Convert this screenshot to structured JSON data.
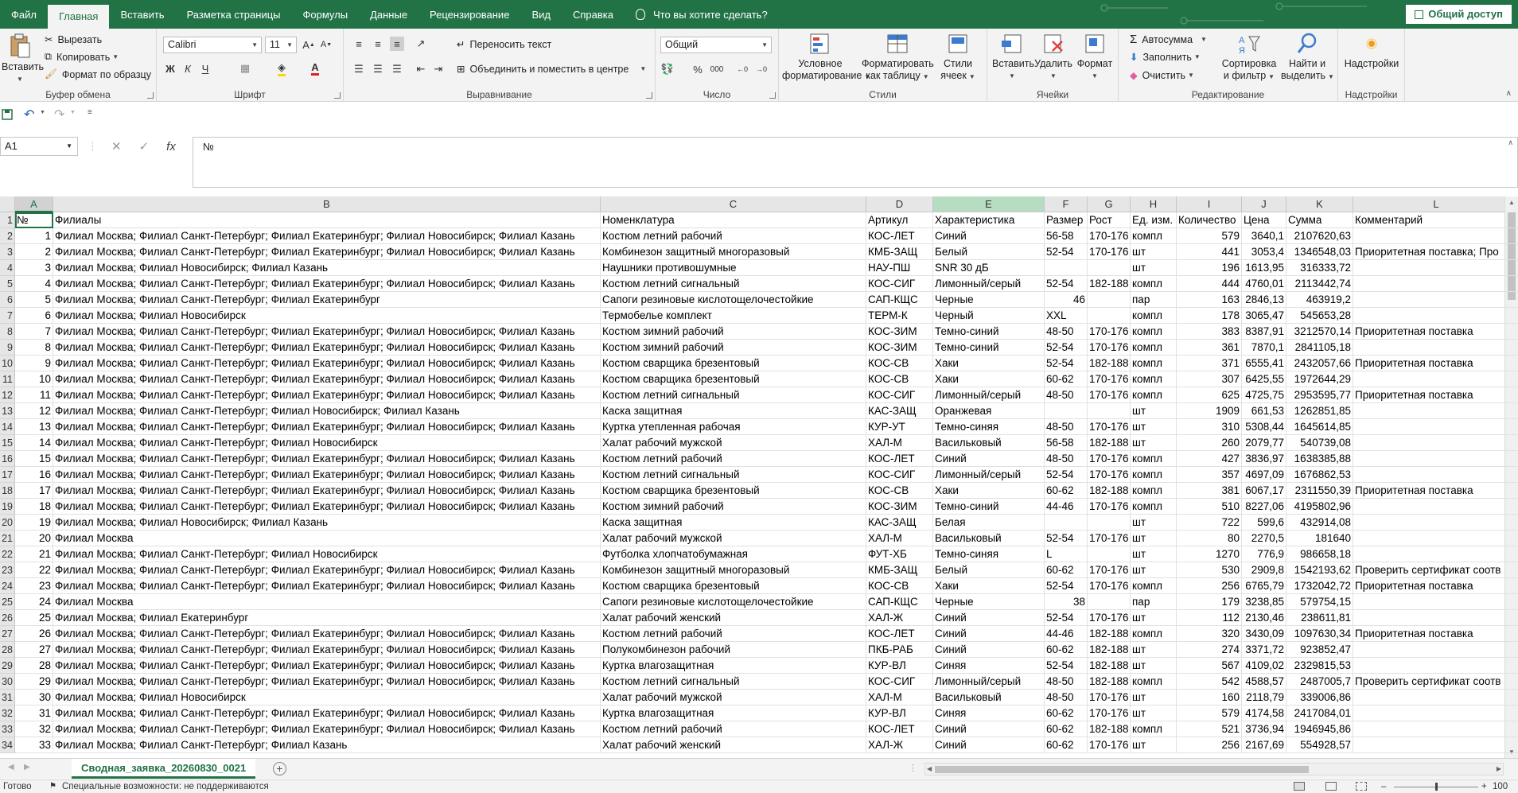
{
  "tabs": [
    "Файл",
    "Главная",
    "Вставить",
    "Разметка страницы",
    "Формулы",
    "Данные",
    "Рецензирование",
    "Вид",
    "Справка"
  ],
  "tell_me": "Что вы хотите сделать?",
  "share": "Общий доступ",
  "ribbon": {
    "clipboard": {
      "paste": "Вставить",
      "cut": "Вырезать",
      "copy": "Копировать",
      "format_painter": "Формат по образцу",
      "label": "Буфер обмена"
    },
    "font": {
      "name": "Calibri",
      "size": "11",
      "bold": "Ж",
      "italic": "К",
      "underline": "Ч",
      "label": "Шрифт"
    },
    "alignment": {
      "wrap": "Переносить текст",
      "merge": "Объединить и поместить в центре",
      "label": "Выравнивание"
    },
    "number": {
      "format": "Общий",
      "label": "Число"
    },
    "styles": {
      "conditional": "Условное форматирование",
      "as_table": "Форматировать как таблицу",
      "cell_styles": "Стили ячеек",
      "label": "Стили"
    },
    "cells": {
      "insert": "Вставить",
      "delete": "Удалить",
      "format": "Формат",
      "label": "Ячейки"
    },
    "editing": {
      "autosum": "Автосумма",
      "fill": "Заполнить",
      "clear": "Очистить",
      "sort": "Сортировка и фильтр",
      "find": "Найти и выделить",
      "label": "Редактирование"
    },
    "addins": {
      "addins": "Надстройки",
      "label": "Надстройки"
    }
  },
  "formula_bar": {
    "name_box": "A1",
    "content": "№"
  },
  "columns": [
    {
      "id": "A",
      "w": 48
    },
    {
      "id": "B",
      "w": 688
    },
    {
      "id": "C",
      "w": 334
    },
    {
      "id": "D",
      "w": 84
    },
    {
      "id": "E",
      "w": 140
    },
    {
      "id": "F",
      "w": 54
    },
    {
      "id": "G",
      "w": 54
    },
    {
      "id": "H",
      "w": 58
    },
    {
      "id": "I",
      "w": 82
    },
    {
      "id": "J",
      "w": 56
    },
    {
      "id": "K",
      "w": 84
    },
    {
      "id": "L",
      "w": 209
    }
  ],
  "headers": [
    "№",
    "Филиалы",
    "Номенклатура",
    "Артикул",
    "Характеристика",
    "Размер",
    "Рост",
    "Ед. изм.",
    "Количество",
    "Цена",
    "Сумма",
    "Комментарий"
  ],
  "rows": [
    [
      "1",
      "Филиал Москва; Филиал Санкт-Петербург; Филиал Екатеринбург; Филиал Новосибирск; Филиал Казань",
      "Костюм летний рабочий",
      "КОС-ЛЕТ",
      "Синий",
      "56-58",
      "170-176",
      "компл",
      "579",
      "3640,1",
      "2107620,63",
      ""
    ],
    [
      "2",
      "Филиал Москва; Филиал Санкт-Петербург; Филиал Екатеринбург; Филиал Новосибирск; Филиал Казань",
      "Комбинезон защитный многоразовый",
      "КМБ-ЗАЩ",
      "Белый",
      "52-54",
      "170-176",
      "шт",
      "441",
      "3053,4",
      "1346548,03",
      "Приоритетная поставка; Про"
    ],
    [
      "3",
      "Филиал Москва; Филиал Новосибирск; Филиал Казань",
      "Наушники противошумные",
      "НАУ-ПШ",
      "SNR 30 дБ",
      "",
      "",
      "шт",
      "196",
      "1613,95",
      "316333,72",
      ""
    ],
    [
      "4",
      "Филиал Москва; Филиал Санкт-Петербург; Филиал Екатеринбург; Филиал Новосибирск; Филиал Казань",
      "Костюм летний сигнальный",
      "КОС-СИГ",
      "Лимонный/серый",
      "52-54",
      "182-188",
      "компл",
      "444",
      "4760,01",
      "2113442,74",
      ""
    ],
    [
      "5",
      "Филиал Москва; Филиал Санкт-Петербург; Филиал Екатеринбург",
      "Сапоги резиновые кислотощелочестойкие",
      "САП-КЩС",
      "Черные",
      "46",
      "",
      "пар",
      "163",
      "2846,13",
      "463919,2",
      ""
    ],
    [
      "6",
      "Филиал Москва; Филиал Новосибирск",
      "Термобелье комплект",
      "ТЕРМ-К",
      "Черный",
      "XXL",
      "",
      "компл",
      "178",
      "3065,47",
      "545653,28",
      ""
    ],
    [
      "7",
      "Филиал Москва; Филиал Санкт-Петербург; Филиал Екатеринбург; Филиал Новосибирск; Филиал Казань",
      "Костюм зимний рабочий",
      "КОС-ЗИМ",
      "Темно-синий",
      "48-50",
      "170-176",
      "компл",
      "383",
      "8387,91",
      "3212570,14",
      "Приоритетная поставка"
    ],
    [
      "8",
      "Филиал Москва; Филиал Санкт-Петербург; Филиал Екатеринбург; Филиал Новосибирск; Филиал Казань",
      "Костюм зимний рабочий",
      "КОС-ЗИМ",
      "Темно-синий",
      "52-54",
      "170-176",
      "компл",
      "361",
      "7870,1",
      "2841105,18",
      ""
    ],
    [
      "9",
      "Филиал Москва; Филиал Санкт-Петербург; Филиал Екатеринбург; Филиал Новосибирск; Филиал Казань",
      "Костюм сварщика брезентовый",
      "КОС-СВ",
      "Хаки",
      "52-54",
      "182-188",
      "компл",
      "371",
      "6555,41",
      "2432057,66",
      "Приоритетная поставка"
    ],
    [
      "10",
      "Филиал Москва; Филиал Санкт-Петербург; Филиал Екатеринбург; Филиал Новосибирск; Филиал Казань",
      "Костюм сварщика брезентовый",
      "КОС-СВ",
      "Хаки",
      "60-62",
      "170-176",
      "компл",
      "307",
      "6425,55",
      "1972644,29",
      ""
    ],
    [
      "11",
      "Филиал Москва; Филиал Санкт-Петербург; Филиал Екатеринбург; Филиал Новосибирск; Филиал Казань",
      "Костюм летний сигнальный",
      "КОС-СИГ",
      "Лимонный/серый",
      "48-50",
      "170-176",
      "компл",
      "625",
      "4725,75",
      "2953595,77",
      "Приоритетная поставка"
    ],
    [
      "12",
      "Филиал Москва; Филиал Санкт-Петербург; Филиал Новосибирск; Филиал Казань",
      "Каска защитная",
      "КАС-ЗАЩ",
      "Оранжевая",
      "",
      "",
      "шт",
      "1909",
      "661,53",
      "1262851,85",
      ""
    ],
    [
      "13",
      "Филиал Москва; Филиал Санкт-Петербург; Филиал Екатеринбург; Филиал Новосибирск; Филиал Казань",
      "Куртка утепленная рабочая",
      "КУР-УТ",
      "Темно-синяя",
      "48-50",
      "170-176",
      "шт",
      "310",
      "5308,44",
      "1645614,85",
      ""
    ],
    [
      "14",
      "Филиал Москва; Филиал Санкт-Петербург; Филиал Новосибирск",
      "Халат рабочий мужской",
      "ХАЛ-М",
      "Васильковый",
      "56-58",
      "182-188",
      "шт",
      "260",
      "2079,77",
      "540739,08",
      ""
    ],
    [
      "15",
      "Филиал Москва; Филиал Санкт-Петербург; Филиал Екатеринбург; Филиал Новосибирск; Филиал Казань",
      "Костюм летний рабочий",
      "КОС-ЛЕТ",
      "Синий",
      "48-50",
      "170-176",
      "компл",
      "427",
      "3836,97",
      "1638385,88",
      ""
    ],
    [
      "16",
      "Филиал Москва; Филиал Санкт-Петербург; Филиал Екатеринбург; Филиал Новосибирск; Филиал Казань",
      "Костюм летний сигнальный",
      "КОС-СИГ",
      "Лимонный/серый",
      "52-54",
      "170-176",
      "компл",
      "357",
      "4697,09",
      "1676862,53",
      ""
    ],
    [
      "17",
      "Филиал Москва; Филиал Санкт-Петербург; Филиал Екатеринбург; Филиал Новосибирск; Филиал Казань",
      "Костюм сварщика брезентовый",
      "КОС-СВ",
      "Хаки",
      "60-62",
      "182-188",
      "компл",
      "381",
      "6067,17",
      "2311550,39",
      "Приоритетная поставка"
    ],
    [
      "18",
      "Филиал Москва; Филиал Санкт-Петербург; Филиал Екатеринбург; Филиал Новосибирск; Филиал Казань",
      "Костюм зимний рабочий",
      "КОС-ЗИМ",
      "Темно-синий",
      "44-46",
      "170-176",
      "компл",
      "510",
      "8227,06",
      "4195802,96",
      ""
    ],
    [
      "19",
      "Филиал Москва; Филиал Новосибирск; Филиал Казань",
      "Каска защитная",
      "КАС-ЗАЩ",
      "Белая",
      "",
      "",
      "шт",
      "722",
      "599,6",
      "432914,08",
      ""
    ],
    [
      "20",
      "Филиал Москва",
      "Халат рабочий мужской",
      "ХАЛ-М",
      "Васильковый",
      "52-54",
      "170-176",
      "шт",
      "80",
      "2270,5",
      "181640",
      ""
    ],
    [
      "21",
      "Филиал Москва; Филиал Санкт-Петербург; Филиал Новосибирск",
      "Футболка хлопчатобумажная",
      "ФУТ-ХБ",
      "Темно-синяя",
      "L",
      "",
      "шт",
      "1270",
      "776,9",
      "986658,18",
      ""
    ],
    [
      "22",
      "Филиал Москва; Филиал Санкт-Петербург; Филиал Екатеринбург; Филиал Новосибирск; Филиал Казань",
      "Комбинезон защитный многоразовый",
      "КМБ-ЗАЩ",
      "Белый",
      "60-62",
      "170-176",
      "шт",
      "530",
      "2909,8",
      "1542193,62",
      "Проверить сертификат соотв"
    ],
    [
      "23",
      "Филиал Москва; Филиал Санкт-Петербург; Филиал Екатеринбург; Филиал Новосибирск; Филиал Казань",
      "Костюм сварщика брезентовый",
      "КОС-СВ",
      "Хаки",
      "52-54",
      "170-176",
      "компл",
      "256",
      "6765,79",
      "1732042,72",
      "Приоритетная поставка"
    ],
    [
      "24",
      "Филиал Москва",
      "Сапоги резиновые кислотощелочестойкие",
      "САП-КЩС",
      "Черные",
      "38",
      "",
      "пар",
      "179",
      "3238,85",
      "579754,15",
      ""
    ],
    [
      "25",
      "Филиал Москва; Филиал Екатеринбург",
      "Халат рабочий женский",
      "ХАЛ-Ж",
      "Синий",
      "52-54",
      "170-176",
      "шт",
      "112",
      "2130,46",
      "238611,81",
      ""
    ],
    [
      "26",
      "Филиал Москва; Филиал Санкт-Петербург; Филиал Екатеринбург; Филиал Новосибирск; Филиал Казань",
      "Костюм летний рабочий",
      "КОС-ЛЕТ",
      "Синий",
      "44-46",
      "182-188",
      "компл",
      "320",
      "3430,09",
      "1097630,34",
      "Приоритетная поставка"
    ],
    [
      "27",
      "Филиал Москва; Филиал Санкт-Петербург; Филиал Екатеринбург; Филиал Новосибирск; Филиал Казань",
      "Полукомбинезон рабочий",
      "ПКБ-РАБ",
      "Синий",
      "60-62",
      "182-188",
      "шт",
      "274",
      "3371,72",
      "923852,47",
      ""
    ],
    [
      "28",
      "Филиал Москва; Филиал Санкт-Петербург; Филиал Екатеринбург; Филиал Новосибирск; Филиал Казань",
      "Куртка влагозащитная",
      "КУР-ВЛ",
      "Синяя",
      "52-54",
      "182-188",
      "шт",
      "567",
      "4109,02",
      "2329815,53",
      ""
    ],
    [
      "29",
      "Филиал Москва; Филиал Санкт-Петербург; Филиал Екатеринбург; Филиал Новосибирск; Филиал Казань",
      "Костюм летний сигнальный",
      "КОС-СИГ",
      "Лимонный/серый",
      "48-50",
      "182-188",
      "компл",
      "542",
      "4588,57",
      "2487005,7",
      "Проверить сертификат соотв"
    ],
    [
      "30",
      "Филиал Москва; Филиал Новосибирск",
      "Халат рабочий мужской",
      "ХАЛ-М",
      "Васильковый",
      "48-50",
      "170-176",
      "шт",
      "160",
      "2118,79",
      "339006,86",
      ""
    ],
    [
      "31",
      "Филиал Москва; Филиал Санкт-Петербург; Филиал Екатеринбург; Филиал Новосибирск; Филиал Казань",
      "Куртка влагозащитная",
      "КУР-ВЛ",
      "Синяя",
      "60-62",
      "170-176",
      "шт",
      "579",
      "4174,58",
      "2417084,01",
      ""
    ],
    [
      "32",
      "Филиал Москва; Филиал Санкт-Петербург; Филиал Екатеринбург; Филиал Новосибирск; Филиал Казань",
      "Костюм летний рабочий",
      "КОС-ЛЕТ",
      "Синий",
      "60-62",
      "182-188",
      "компл",
      "521",
      "3736,94",
      "1946945,86",
      ""
    ],
    [
      "33",
      "Филиал Москва; Филиал Санкт-Петербург; Филиал Казань",
      "Халат рабочий женский",
      "ХАЛ-Ж",
      "Синий",
      "60-62",
      "170-176",
      "шт",
      "256",
      "2167,69",
      "554928,57",
      ""
    ]
  ],
  "sheet_tab": "Сводная_заявка_20260830_0021",
  "status": {
    "ready": "Готово",
    "accessibility": "Специальные возможности: не поддерживаются",
    "zoom": "100 %"
  },
  "colors": {
    "accent": "#217346",
    "ribbon_bg": "#f3f3f3",
    "header_bg": "#e6e6e6",
    "highlight_col": "#b6dcc2"
  }
}
